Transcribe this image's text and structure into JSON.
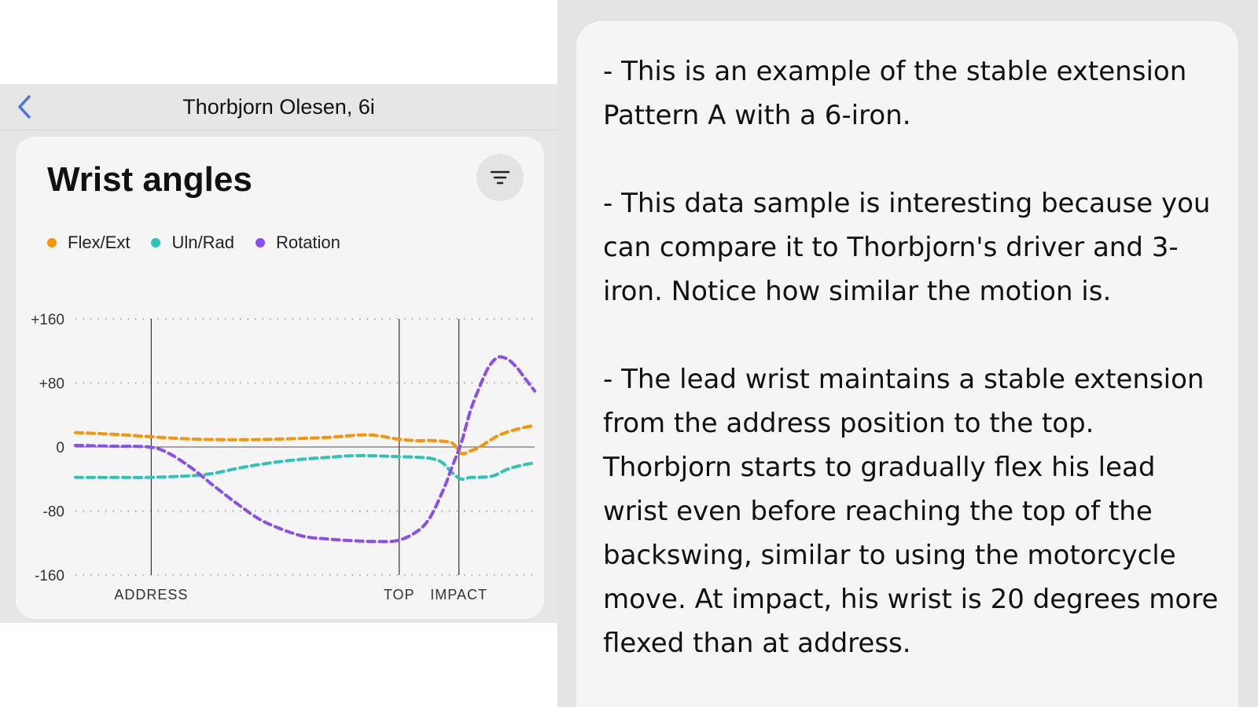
{
  "header": {
    "title": "Thorbjorn Olesen, 6i"
  },
  "card": {
    "title": "Wrist angles"
  },
  "legend": [
    {
      "label": "Flex/Ext",
      "color": "#f5960a"
    },
    {
      "label": "Uln/Rad",
      "color": "#2ec4b6"
    },
    {
      "label": "Rotation",
      "color": "#8a4ef0"
    }
  ],
  "icons": {
    "back": "chevron-left-icon",
    "filter": "filter-lines-icon"
  },
  "chart_data": {
    "type": "line",
    "y_ticks": [
      "+160",
      "+80",
      "0",
      "-80",
      "-160"
    ],
    "ylim": [
      -160,
      160
    ],
    "xlim": [
      0,
      100
    ],
    "events": [
      {
        "label": "ADDRESS",
        "x": 16.5
      },
      {
        "label": "TOP",
        "x": 70.5
      },
      {
        "label": "IMPACT",
        "x": 83.5
      }
    ],
    "grid": "dotted horizontal at y ticks",
    "legend_position": "top-left",
    "series": [
      {
        "name": "Flex/Ext",
        "color": "#f5960a",
        "x": [
          0,
          8,
          16,
          25,
          35,
          45,
          55,
          62,
          66,
          70,
          74,
          78,
          82,
          84,
          86,
          88,
          92,
          96,
          100
        ],
        "y": [
          18,
          16,
          13,
          10,
          9,
          10,
          12,
          15,
          14,
          10,
          8,
          8,
          5,
          -8,
          -5,
          0,
          14,
          22,
          27
        ]
      },
      {
        "name": "Uln/Rad",
        "color": "#2ec4b6",
        "x": [
          0,
          8,
          16,
          25,
          30,
          35,
          40,
          45,
          50,
          55,
          60,
          65,
          70,
          75,
          78,
          80,
          82,
          84,
          86,
          88,
          91,
          94,
          97,
          100
        ],
        "y": [
          -38,
          -38,
          -38,
          -36,
          -33,
          -27,
          -22,
          -18,
          -15,
          -13,
          -11,
          -11,
          -12,
          -13,
          -15,
          -20,
          -32,
          -40,
          -38,
          -38,
          -36,
          -28,
          -23,
          -20
        ]
      },
      {
        "name": "Rotation",
        "color": "#8a4ef0",
        "x": [
          0,
          8,
          16,
          20,
          25,
          30,
          35,
          40,
          45,
          50,
          55,
          60,
          65,
          70,
          74,
          77,
          80,
          82,
          84,
          86,
          88,
          90,
          92,
          94,
          96,
          98,
          100
        ],
        "y": [
          2,
          1,
          0,
          -7,
          -25,
          -48,
          -70,
          -90,
          -103,
          -112,
          -115,
          -117,
          -118,
          -117,
          -107,
          -90,
          -55,
          -25,
          5,
          45,
          75,
          100,
          112,
          110,
          100,
          85,
          70
        ]
      }
    ]
  },
  "notes": [
    "- This is an example of the stable extension Pattern A with a 6-iron.",
    "- This data sample is interesting because you can compare it to Thorbjorn's driver and 3-iron. Notice how similar the motion is.",
    "- The lead wrist maintains a stable extension from the address position to the top. Thorbjorn starts to gradually flex his lead wrist even before reaching the top of the backswing, similar to using the motorcycle move. At impact, his wrist is 20 degrees more flexed than at address."
  ]
}
